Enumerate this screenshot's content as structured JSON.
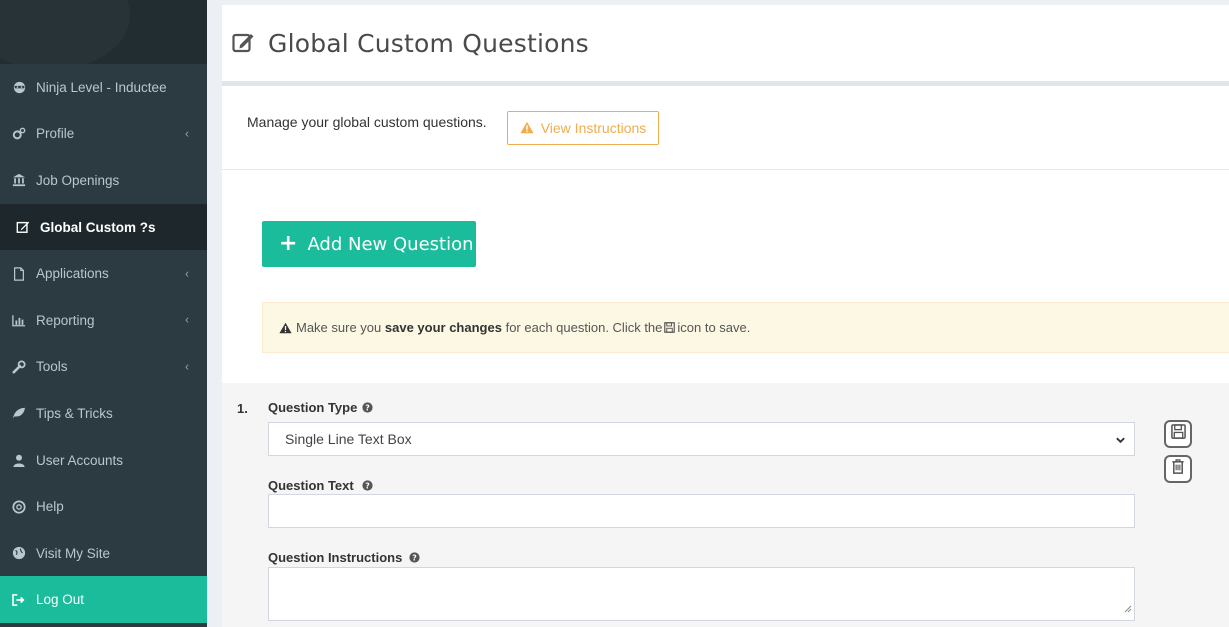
{
  "sidebar": {
    "items": [
      {
        "label": "Ninja Level - Inductee",
        "icon": "ninja-icon"
      },
      {
        "label": "Profile",
        "icon": "cogs-icon",
        "has_chevron": true
      },
      {
        "label": "Job Openings",
        "icon": "bank-icon"
      },
      {
        "label": "Global Custom ?s",
        "icon": "edit-icon",
        "active": true
      },
      {
        "label": "Applications",
        "icon": "file-icon",
        "has_chevron": true
      },
      {
        "label": "Reporting",
        "icon": "bar-chart-icon",
        "has_chevron": true
      },
      {
        "label": "Tools",
        "icon": "wrench-icon",
        "has_chevron": true
      },
      {
        "label": "Tips & Tricks",
        "icon": "leaf-icon"
      },
      {
        "label": "User Accounts",
        "icon": "user-icon"
      },
      {
        "label": "Help",
        "icon": "life-ring-icon"
      },
      {
        "label": "Visit My Site",
        "icon": "globe-icon"
      }
    ],
    "logout_label": "Log Out",
    "chevron": "‹"
  },
  "header": {
    "title": "Global Custom Questions"
  },
  "intro": {
    "text": "Manage your global custom questions.",
    "instructions_button": "View Instructions"
  },
  "add_button": {
    "plus": "+",
    "label": "Add New Question"
  },
  "alert": {
    "prefix": "Make sure you",
    "bold": "save your changes",
    "middle": "for each question. Click the",
    "suffix": "icon to save."
  },
  "question": {
    "number": "1.",
    "type_label": "Question Type",
    "type_value": "Single Line Text Box",
    "text_label": "Question Text",
    "text_value": "",
    "instructions_label": "Question Instructions",
    "instructions_value": ""
  },
  "colors": {
    "accent": "#1abc9c",
    "sidebar_bg": "#2c3b41",
    "warning": "#f0ad4e",
    "alert_bg": "#fcf8e3"
  }
}
